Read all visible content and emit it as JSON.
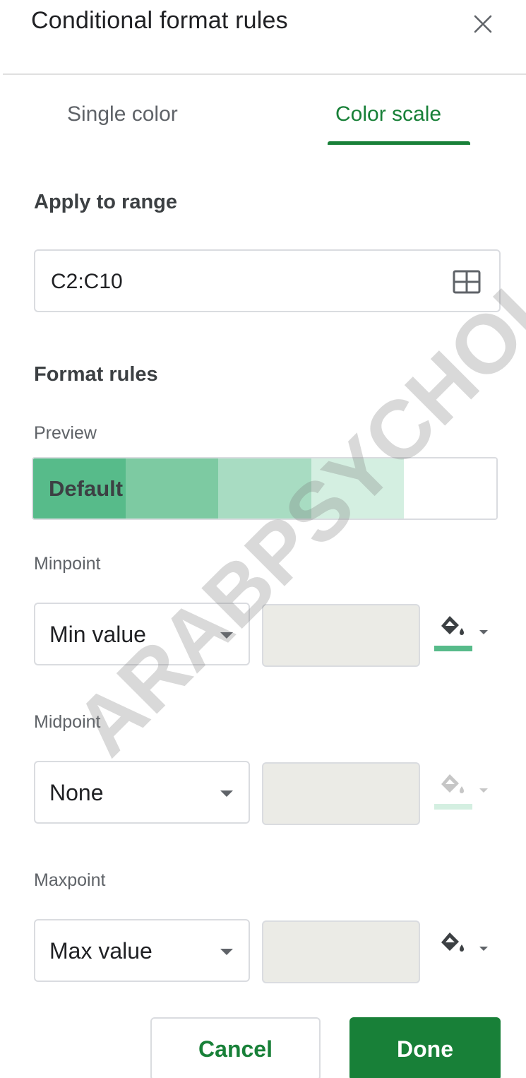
{
  "dialog": {
    "title": "Conditional format rules",
    "close_icon": "close-icon"
  },
  "tabs": [
    {
      "label": "Single color",
      "active": false
    },
    {
      "label": "Color scale",
      "active": true
    }
  ],
  "apply_to_range": {
    "label": "Apply to range",
    "value": "C2:C10",
    "icon": "grid-select-icon"
  },
  "format_rules": {
    "label": "Format rules",
    "preview_label": "Preview",
    "preview_text": "Default",
    "preview_colors": [
      "#57bb8a",
      "#7dcaa2",
      "#a8dcc2",
      "#d4efe1",
      "#ffffff"
    ]
  },
  "minpoint": {
    "label": "Minpoint",
    "type": "Min value",
    "value": "",
    "color": "#57bb8a",
    "fill_icon": "paint-bucket-icon"
  },
  "midpoint": {
    "label": "Midpoint",
    "type": "None",
    "value": "",
    "color": "#d4efe1",
    "fill_icon": "paint-bucket-icon",
    "disabled": true
  },
  "maxpoint": {
    "label": "Maxpoint",
    "type": "Max value",
    "value": "",
    "color": "#ffffff",
    "fill_icon": "paint-bucket-icon"
  },
  "buttons": {
    "cancel": "Cancel",
    "done": "Done"
  },
  "colors": {
    "accent": "#188038"
  },
  "watermark": "ARABPSYCHOL"
}
